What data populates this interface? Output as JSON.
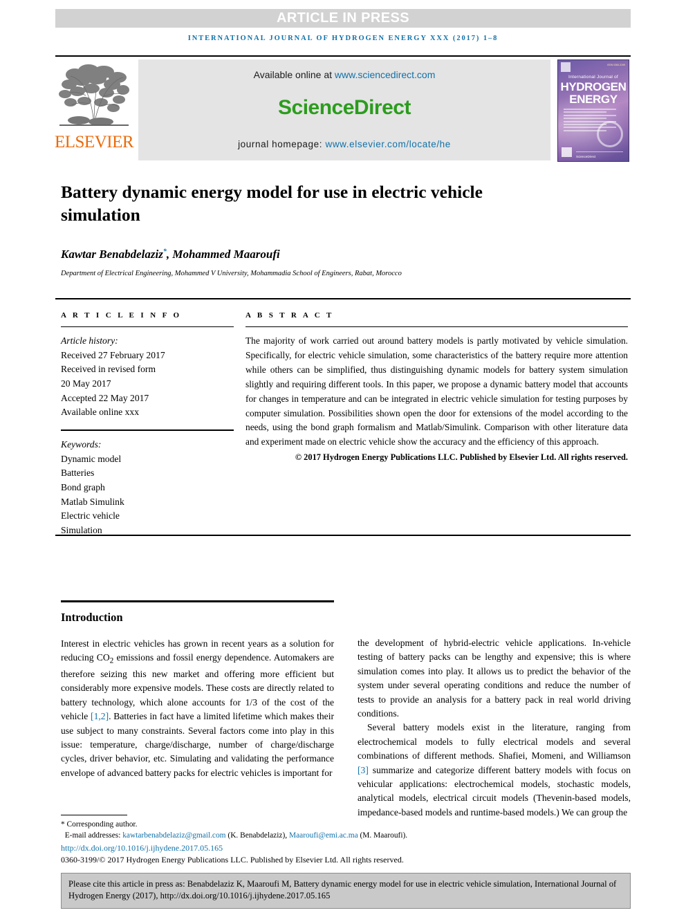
{
  "banner": {
    "press_label": "ARTICLE IN PRESS",
    "journal_line": "INTERNATIONAL JOURNAL OF HYDROGEN ENERGY XXX (2017) 1–8"
  },
  "masthead": {
    "publisher_name": "ELSEVIER",
    "available_prefix": "Available online at ",
    "available_url": "www.sciencedirect.com",
    "sciencedirect_wordmark": "ScienceDirect",
    "homepage_prefix": "journal homepage: ",
    "homepage_url": "www.elsevier.com/locate/he",
    "cover": {
      "line_ijof": "International Journal of",
      "line_hydrogen": "HYDROGEN",
      "line_energy": "ENERGY",
      "footer_word": "ScienceDirect",
      "corner_note": "ISSN 0360-3199"
    },
    "colors": {
      "link_blue": "#1171a8",
      "sciencedirect_green": "#2c9c1e",
      "elsevier_orange": "#eb6a09",
      "banner_gray": "#d2d2d2"
    }
  },
  "article": {
    "title": "Battery dynamic energy model for use in electric vehicle simulation",
    "authors": "Kawtar Benabdelaziz",
    "corresponding_marker": "*",
    "authors_rest": ", Mohammed Maaroufi",
    "affiliation": "Department of Electrical Engineering, Mohammed V University, Mohammadia School of Engineers, Rabat, Morocco"
  },
  "info": {
    "heading": "A R T I C L E   I N F O",
    "history_label": "Article history:",
    "history": [
      "Received 27 February 2017",
      "Received in revised form",
      "20 May 2017",
      "Accepted 22 May 2017",
      "Available online xxx"
    ],
    "keywords_label": "Keywords:",
    "keywords": [
      "Dynamic model",
      "Batteries",
      "Bond graph",
      "Matlab Simulink",
      "Electric vehicle",
      "Simulation"
    ]
  },
  "abstract": {
    "heading": "A B S T R A C T",
    "text": "The majority of work carried out around battery models is partly motivated by vehicle simulation. Specifically, for electric vehicle simulation, some characteristics of the battery require more attention while others can be simplified, thus distinguishing dynamic models for battery system simulation slightly and requiring different tools. In this paper, we propose a dynamic battery model that accounts for changes in temperature and can be integrated in electric vehicle simulation for testing purposes by computer simulation. Possibilities shown open the door for extensions of the model according to the needs, using the bond graph formalism and Matlab/Simulink. Comparison with other literature data and experiment made on electric vehicle show the accuracy and the efficiency of this approach.",
    "copyright": "© 2017 Hydrogen Energy Publications LLC. Published by Elsevier Ltd. All rights reserved."
  },
  "body": {
    "section_heading": "Introduction",
    "left_paragraph_1_a": "Interest in electric vehicles has grown in recent years as a solution for reducing CO",
    "left_paragraph_1_sub": "2",
    "left_paragraph_1_b": " emissions and fossil energy dependence. Automakers are therefore seizing this new market and offering more efficient but considerably more expensive models. These costs are directly related to battery technology, which alone accounts for 1/3 of the cost of the vehicle ",
    "left_ref_1": "[1,2]",
    "left_paragraph_1_c": ". Batteries in fact have a limited lifetime which makes their use subject to many constraints. Several factors come into play in this issue: temperature, charge/discharge, number of charge/discharge cycles, driver behavior, etc. Simulating and validating the performance envelope of advanced battery packs for electric vehicles is important for",
    "right_paragraph_1": "the development of hybrid-electric vehicle applications. In-vehicle testing of battery packs can be lengthy and expensive; this is where simulation comes into play. It allows us to predict the behavior of the system under several operating conditions and reduce the number of tests to provide an analysis for a battery pack in real world driving conditions.",
    "right_paragraph_2_a": "Several battery models exist in the literature, ranging from electrochemical models to fully electrical models and several combinations of different methods. Shafiei, Momeni, and Williamson ",
    "right_ref_3": "[3]",
    "right_paragraph_2_b": " summarize and categorize different battery models with focus on vehicular applications: electrochemical models, stochastic models, analytical models, electrical circuit models (Thevenin-based models, impedance-based models and runtime-based models.) We can group the"
  },
  "footer": {
    "corresponding": "* Corresponding author.",
    "email_label": "E-mail addresses: ",
    "email_1": "kawtarbenabdelaziz@gmail.com",
    "email_1_name": " (K. Benabdelaziz), ",
    "email_2": "Maaroufi@emi.ac.ma",
    "email_2_name": " (M. Maaroufi).",
    "doi": "http://dx.doi.org/10.1016/j.ijhydene.2017.05.165",
    "issn_line": "0360-3199/© 2017 Hydrogen Energy Publications LLC. Published by Elsevier Ltd. All rights reserved."
  },
  "citation_box": {
    "text": "Please cite this article in press as: Benabdelaziz K, Maaroufi M, Battery dynamic energy model for use in electric vehicle simulation, International Journal of Hydrogen Energy (2017), http://dx.doi.org/10.1016/j.ijhydene.2017.05.165"
  }
}
